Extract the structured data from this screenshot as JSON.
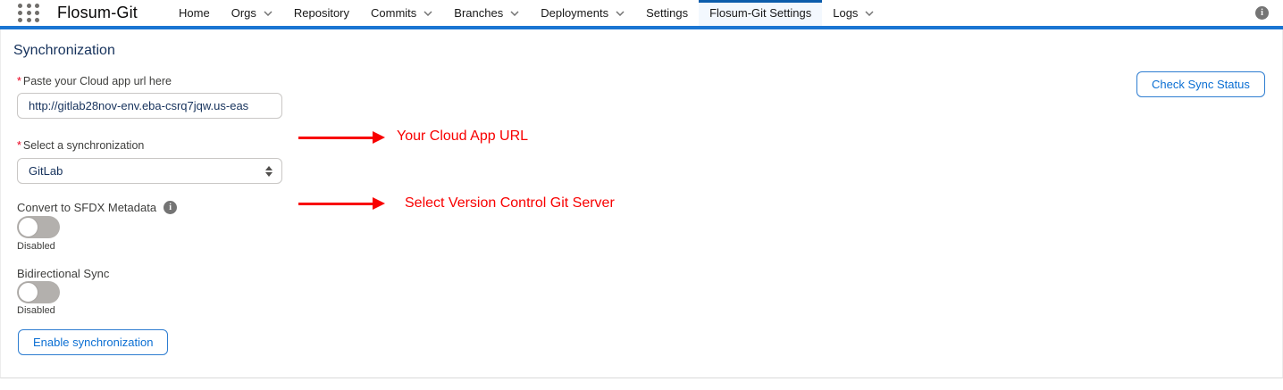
{
  "nav": {
    "app_name": "Flosum-Git",
    "items": [
      {
        "label": "Home"
      },
      {
        "label": "Orgs",
        "chevron": true
      },
      {
        "label": "Repository"
      },
      {
        "label": "Commits",
        "chevron": true
      },
      {
        "label": "Branches",
        "chevron": true
      },
      {
        "label": "Deployments",
        "chevron": true
      },
      {
        "label": "Settings"
      },
      {
        "label": "Flosum-Git Settings",
        "active": true
      },
      {
        "label": "Logs",
        "chevron": true
      }
    ],
    "info_icon": "info-icon"
  },
  "page": {
    "heading": "Synchronization",
    "url_field": {
      "label": "Paste your Cloud app url here",
      "required": "*",
      "value": "http://gitlab28nov-env.eba-csrq7jqw.us-eas"
    },
    "sync_select": {
      "label": "Select a synchronization",
      "required": "*",
      "value": "GitLab"
    },
    "annotations": [
      {
        "text": "Your Cloud App URL"
      },
      {
        "text": "Select Version Control Git Server"
      }
    ],
    "toggles": [
      {
        "label": "Convert to SFDX Metadata",
        "state": "Disabled",
        "has_info": true
      },
      {
        "label": "Bidirectional Sync",
        "state": "Disabled"
      }
    ],
    "buttons": {
      "check_sync": "Check Sync Status",
      "enable_sync": "Enable synchronization"
    }
  },
  "colors": {
    "nav_underline": "#1a75d2",
    "active_tab_bg": "#f3f8fe",
    "active_tab_indicator": "#0b5cab",
    "heading": "#16325c",
    "annotation_red": "#f80000",
    "button_blue": "#0b6fd3",
    "required_red": "#ea001e",
    "toggle_track": "#b3b0ad"
  }
}
